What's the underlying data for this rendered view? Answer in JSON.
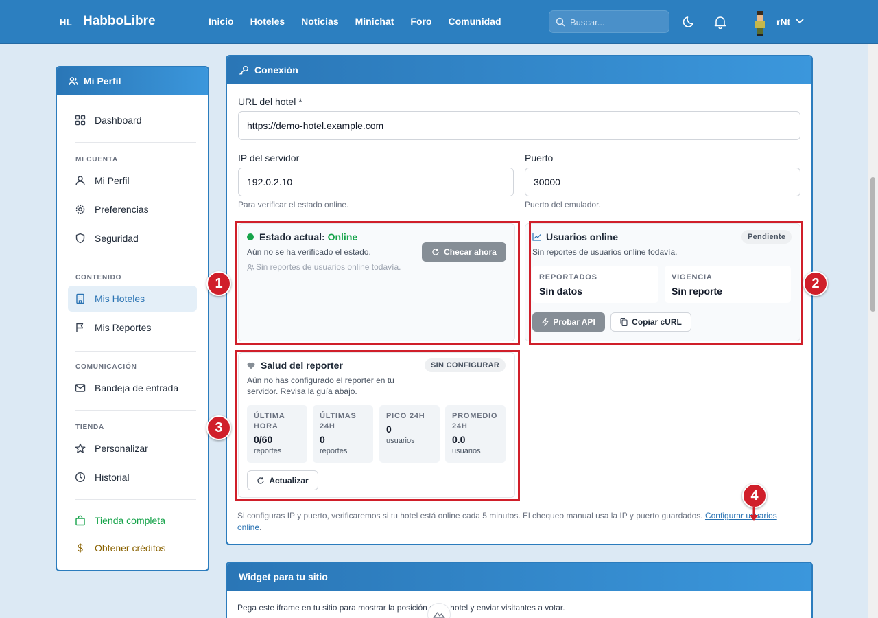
{
  "nav": {
    "logo_mark": "HL",
    "logo_text": "HabboLibre",
    "links": [
      "Inicio",
      "Hoteles",
      "Noticias",
      "Minichat",
      "Foro",
      "Comunidad"
    ],
    "search_placeholder": "Buscar...",
    "user_name": "rNt"
  },
  "sidebar": {
    "title": "Mi Perfil",
    "dashboard": "Dashboard",
    "sections": {
      "account": "MI CUENTA",
      "content": "CONTENIDO",
      "communication": "COMUNICACIÓN",
      "store": "TIENDA"
    },
    "items": {
      "profile": "Mi Perfil",
      "preferences": "Preferencias",
      "security": "Seguridad",
      "hotels": "Mis Hoteles",
      "reports": "Mis Reportes",
      "inbox": "Bandeja de entrada",
      "customize": "Personalizar",
      "history": "Historial",
      "full_store": "Tienda completa",
      "credits": "Obtener créditos"
    }
  },
  "connection": {
    "title": "Conexión",
    "url_label": "URL del hotel *",
    "url_value": "https://demo-hotel.example.com",
    "ip_label": "IP del servidor",
    "ip_value": "192.0.2.10",
    "ip_hint": "Para verificar el estado online.",
    "port_label": "Puerto",
    "port_value": "30000",
    "port_hint": "Puerto del emulador."
  },
  "status": {
    "title_prefix": "Estado actual:",
    "title_value": "Online",
    "not_verified": "Aún no se ha verificado el estado.",
    "no_reports": "Sin reportes de usuarios online todavía.",
    "check_button": "Checar ahora"
  },
  "online_users": {
    "title": "Usuarios online",
    "badge": "Pendiente",
    "subtitle": "Sin reportes de usuarios online todavía.",
    "reported_label": "REPORTADOS",
    "reported_value": "Sin datos",
    "validity_label": "VIGENCIA",
    "validity_value": "Sin reporte",
    "test_api": "Probar API",
    "copy_curl": "Copiar cURL"
  },
  "reporter": {
    "title": "Salud del reporter",
    "badge": "SIN CONFIGURAR",
    "description": "Aún no has configurado el reporter en tu servidor. Revisa la guía abajo.",
    "stats": [
      {
        "label": "ÚLTIMA HORA",
        "value": "0/60",
        "unit": "reportes"
      },
      {
        "label": "ÚLTIMAS 24H",
        "value": "0",
        "unit": "reportes"
      },
      {
        "label": "PICO 24H",
        "value": "0",
        "unit": "usuarios"
      },
      {
        "label": "PROMEDIO 24H",
        "value": "0.0",
        "unit": "usuarios"
      }
    ],
    "refresh": "Actualizar"
  },
  "footer_note": {
    "text": "Si configuras IP y puerto, verificaremos si tu hotel está online cada 5 minutos. El chequeo manual usa la IP y puerto guardados.",
    "link": "Configurar usuarios online",
    "end": "."
  },
  "widget": {
    "title": "Widget para tu sitio",
    "description": "Pega este iframe en tu sitio para mostrar la posición de tu hotel y enviar visitantes a votar."
  },
  "markers": [
    "1",
    "2",
    "3",
    "4"
  ],
  "colors": {
    "brand": "#2c7fc0",
    "online": "#16a34a",
    "annotation": "#d01f2a"
  }
}
